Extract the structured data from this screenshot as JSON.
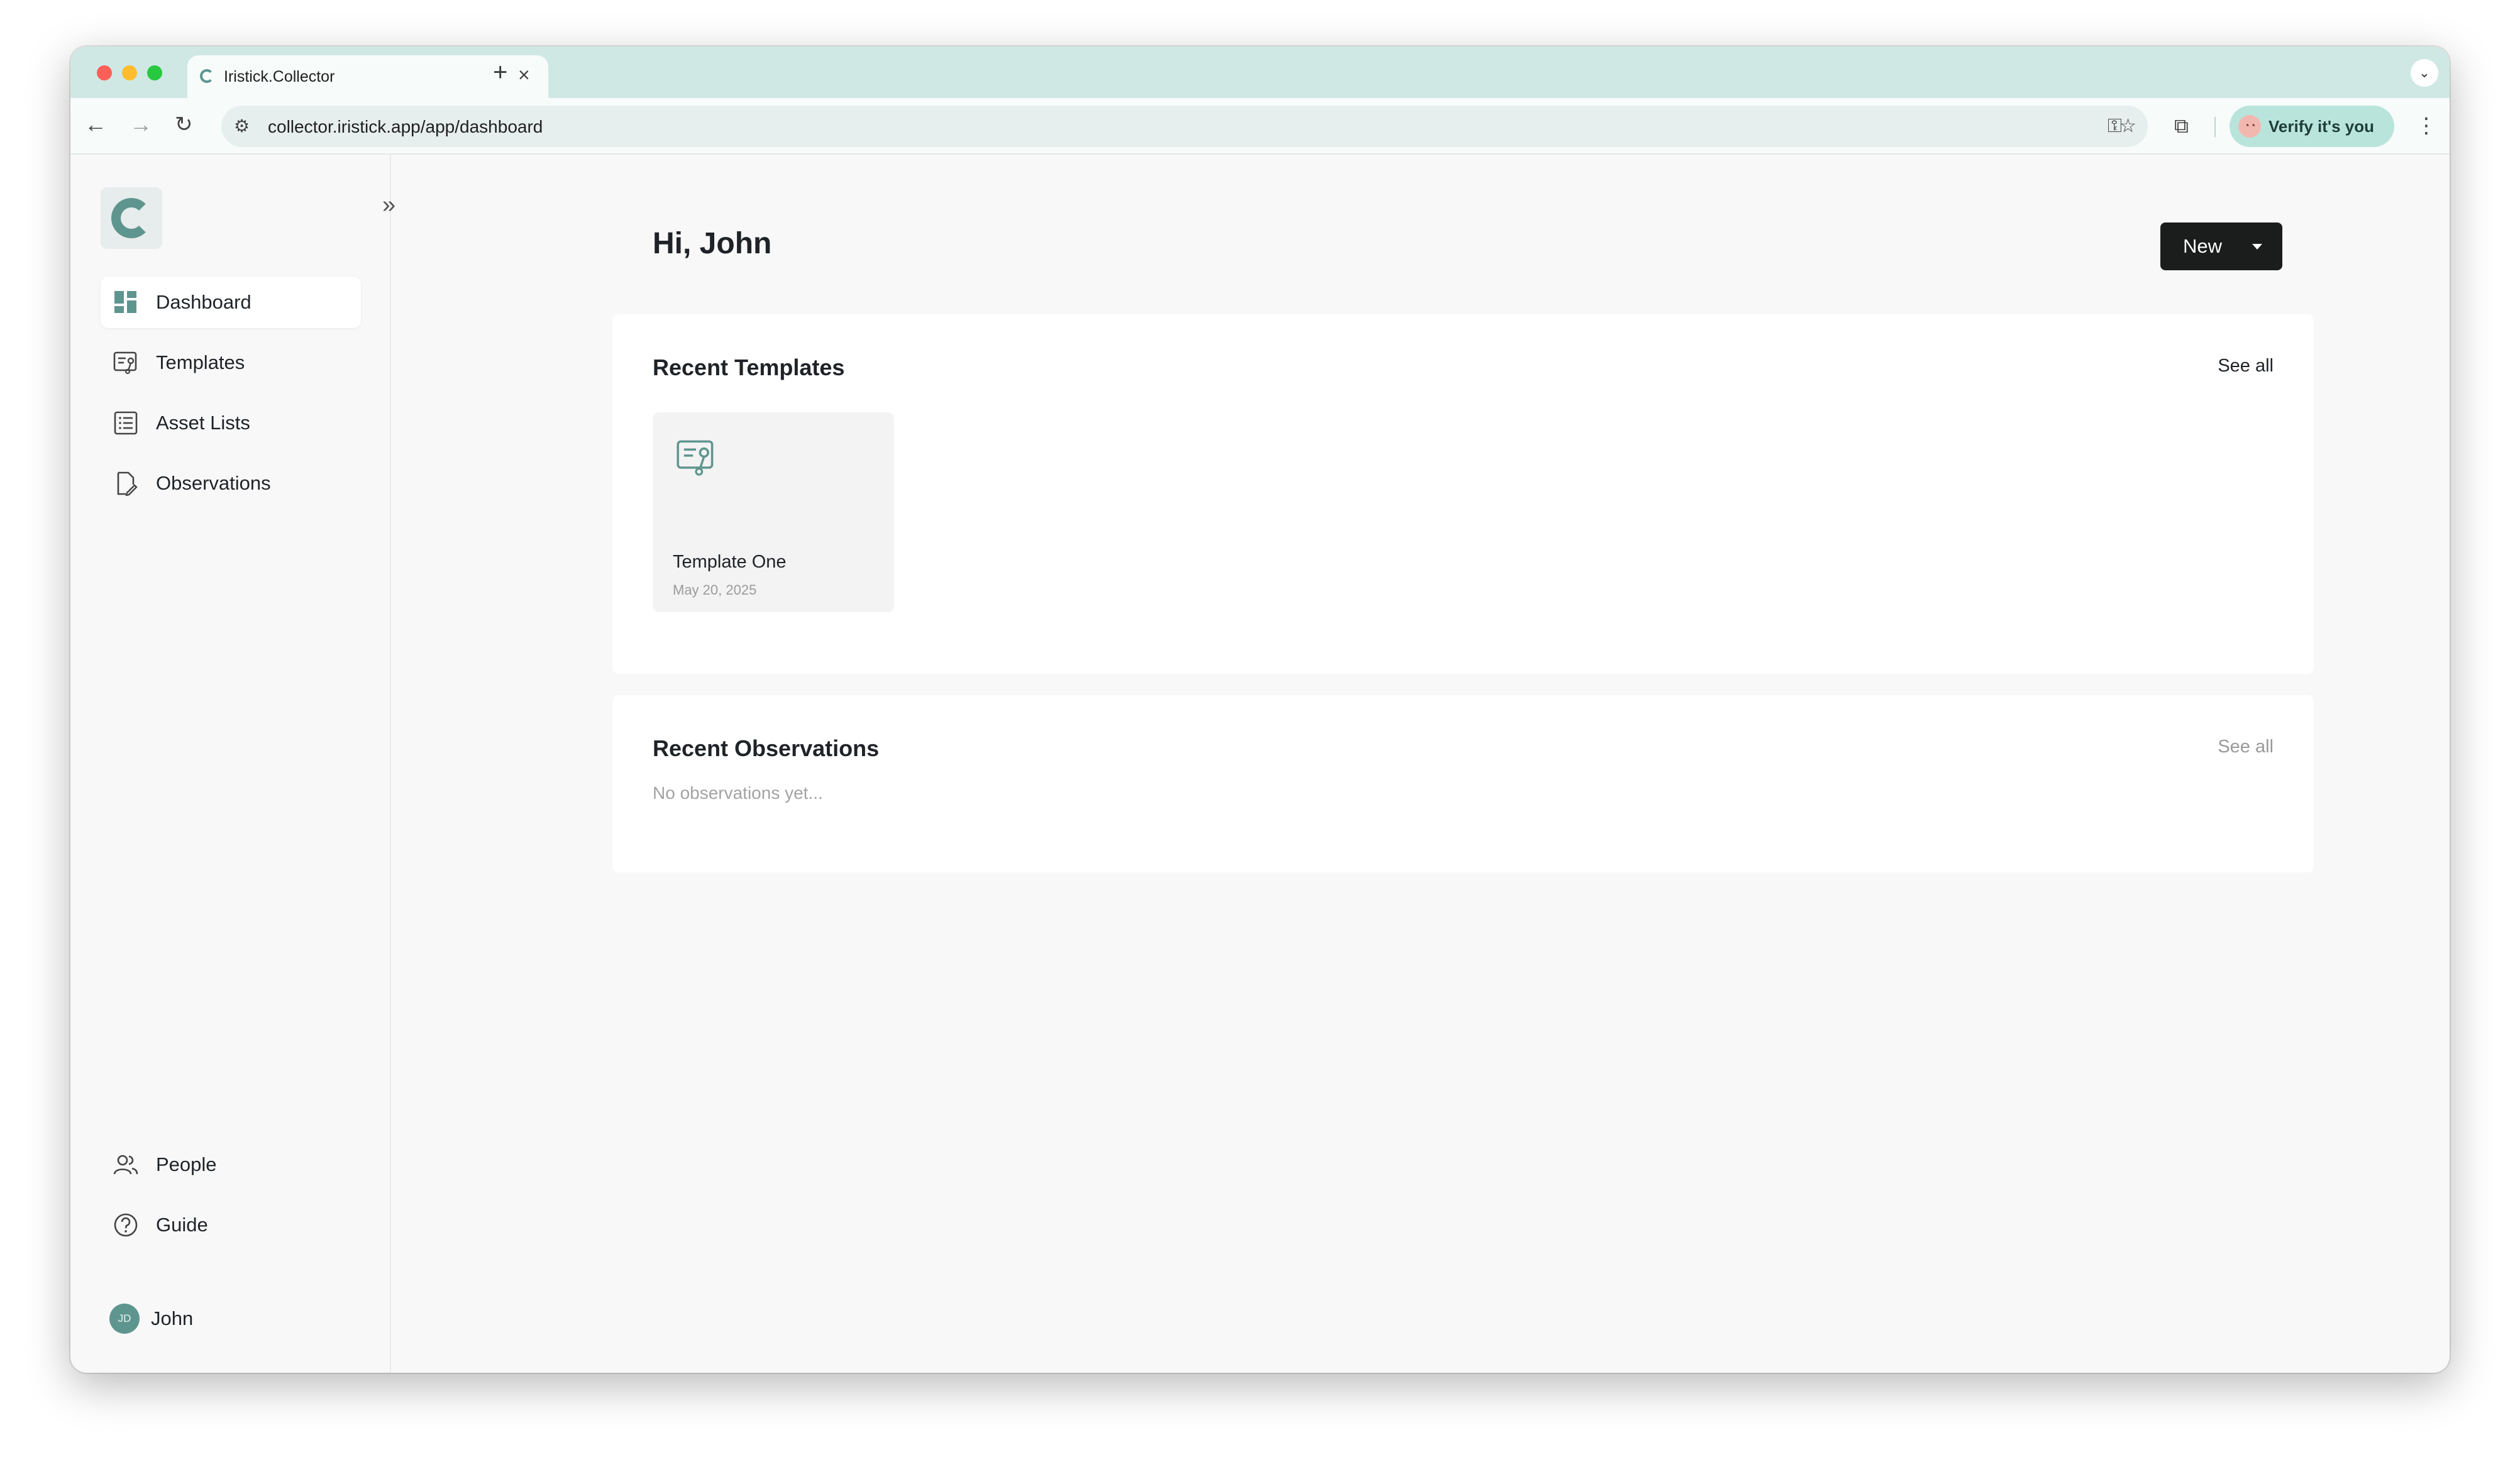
{
  "browser": {
    "tab_title": "Iristick.Collector",
    "tab_close_glyph": "×",
    "new_tab_glyph": "+",
    "tab_dropdown_glyph": "⌄",
    "back_glyph": "←",
    "forward_glyph": "→",
    "reload_glyph": "↻",
    "site_info_glyph": "⚙",
    "url": "collector.iristick.app/app/dashboard",
    "key_glyph": "⚿",
    "star_glyph": "☆",
    "extensions_glyph": "⧉",
    "profile_label": "Verify it's you",
    "profile_avatar": "◔◔",
    "menu_glyph": "⋮",
    "chrome_color": "#cfe8e4",
    "accent": "#b9e4dc"
  },
  "sidebar": {
    "collapse_glyph": "»",
    "items": [
      {
        "label": "Dashboard",
        "icon": "dashboard-icon",
        "active": true
      },
      {
        "label": "Templates",
        "icon": "templates-icon",
        "active": false
      },
      {
        "label": "Asset Lists",
        "icon": "asset-lists-icon",
        "active": false
      },
      {
        "label": "Observations",
        "icon": "observations-icon",
        "active": false
      }
    ],
    "bottom_items": [
      {
        "label": "People",
        "icon": "people-icon"
      },
      {
        "label": "Guide",
        "icon": "guide-icon"
      }
    ],
    "user": {
      "initials": "JD",
      "name": "John"
    },
    "accent": "#5f958f"
  },
  "main": {
    "greeting": "Hi, John",
    "new_button": "New",
    "recent_templates": {
      "title": "Recent Templates",
      "see_all": "See all",
      "items": [
        {
          "name": "Template One",
          "date": "May 20, 2025"
        }
      ]
    },
    "recent_observations": {
      "title": "Recent Observations",
      "see_all": "See all",
      "empty_text": "No observations yet..."
    }
  }
}
